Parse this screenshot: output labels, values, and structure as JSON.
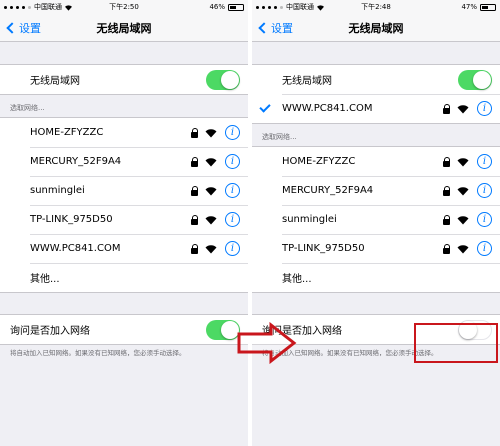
{
  "status": {
    "carrier": "中国联通",
    "left_time": "下午2:50",
    "left_battery": "46%",
    "right_time": "下午2:48",
    "right_battery": "47%",
    "left_battery_level": 0.46,
    "right_battery_level": 0.47
  },
  "nav": {
    "back_label": "设置",
    "title": "无线局域网"
  },
  "wifi_toggle_label": "无线局域网",
  "section_header": "选取网络...",
  "left_networks": [
    {
      "name": "HOME-ZFYZZC"
    },
    {
      "name": "MERCURY_52F9A4"
    },
    {
      "name": "sunminglei"
    },
    {
      "name": "TP-LINK_975D50"
    },
    {
      "name": "WWW.PC841.COM"
    }
  ],
  "right_connected": "WWW.PC841.COM",
  "right_networks": [
    {
      "name": "HOME-ZFYZZC"
    },
    {
      "name": "MERCURY_52F9A4"
    },
    {
      "name": "sunminglei"
    },
    {
      "name": "TP-LINK_975D50"
    }
  ],
  "other_label": "其他...",
  "ask_join_label": "询问是否加入网络",
  "ask_join_note": "将自动加入已知网络。如果没有已知网络，您必须手动选择。",
  "info_glyph": "i",
  "colors": {
    "accent": "#007aff",
    "toggle_on": "#4cd964",
    "highlight": "#c9161c",
    "background": "#efeff4"
  }
}
